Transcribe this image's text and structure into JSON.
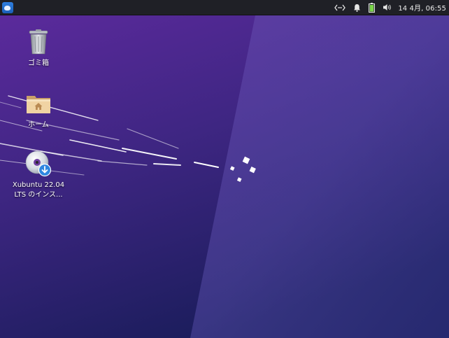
{
  "panel": {
    "menu_icon": "xubuntu-whisker-menu-icon",
    "tray": {
      "network_icon": "network-wired-icon",
      "notifications_icon": "bell-icon",
      "battery_icon": "battery-icon",
      "volume_icon": "speaker-volume-icon"
    },
    "clock": "14 4月, 06:55"
  },
  "desktop": {
    "icons": [
      {
        "label": "ゴミ箱",
        "icon": "trash-icon"
      },
      {
        "label": "ホーム",
        "icon": "home-folder-icon"
      },
      {
        "label": "Xubuntu 22.04",
        "label2": "LTS のインス...",
        "icon": "install-disc-icon"
      }
    ]
  },
  "colors": {
    "panel_bg": "#1f2026",
    "wallpaper_top": "#5a2a9a",
    "wallpaper_bottom": "#1b1f5e",
    "battery": "#7bd44a"
  }
}
